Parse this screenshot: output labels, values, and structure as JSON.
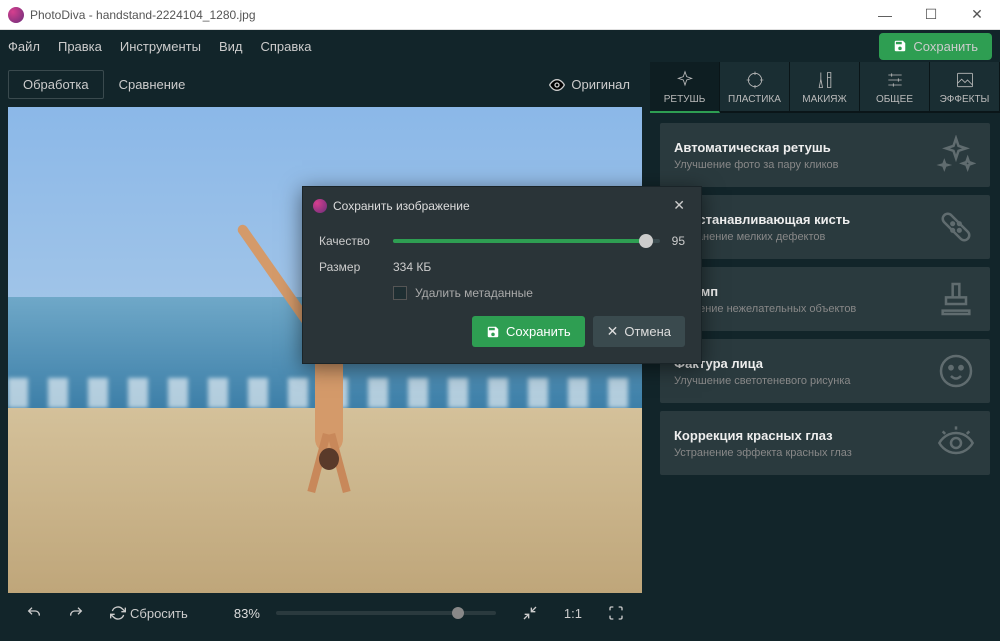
{
  "window": {
    "app": "PhotoDiva",
    "filename": "handstand-2224104_1280.jpg",
    "title": "PhotoDiva - handstand-2224104_1280.jpg"
  },
  "menu": {
    "items": [
      "Файл",
      "Правка",
      "Инструменты",
      "Вид",
      "Справка"
    ],
    "save": "Сохранить"
  },
  "left_tabs": {
    "processing": "Обработка",
    "compare": "Сравнение",
    "original": "Оригинал"
  },
  "bottom": {
    "undo": "↶",
    "redo": "↷",
    "reset": "Сбросить",
    "zoom_pct": "83%",
    "ratio": "1:1"
  },
  "right_tabs": [
    "РЕТУШЬ",
    "ПЛАСТИКА",
    "МАКИЯЖ",
    "ОБЩЕЕ",
    "ЭФФЕКТЫ"
  ],
  "cards": [
    {
      "title": "Автоматическая ретушь",
      "sub": "Улучшение фото за пару кликов"
    },
    {
      "title": "Восстанавливающая кисть",
      "sub": "Устранение мелких дефектов"
    },
    {
      "title": "Штамп",
      "sub": "Удаление нежелательных объектов"
    },
    {
      "title": "Фактура лица",
      "sub": "Улучшение светотеневого рисунка"
    },
    {
      "title": "Коррекция красных глаз",
      "sub": "Устранение эффекта красных глаз"
    }
  ],
  "modal": {
    "title": "Сохранить изображение",
    "quality_label": "Качество",
    "quality_value": "95",
    "size_label": "Размер",
    "size_value": "334 КБ",
    "delete_meta": "Удалить метаданные",
    "save": "Сохранить",
    "cancel": "Отмена"
  }
}
